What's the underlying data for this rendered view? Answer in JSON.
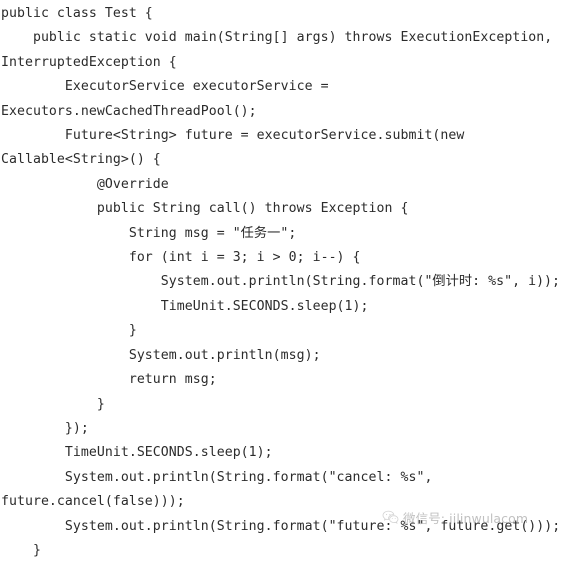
{
  "document": {
    "type": "code-snippet",
    "language": "java",
    "background_color": "#ffffff",
    "text_color": "#2b2b2b"
  },
  "code": {
    "lines": [
      "public class Test {",
      "    public static void main(String[] args) throws ExecutionException,",
      "InterruptedException {",
      "        ExecutorService executorService =",
      "Executors.newCachedThreadPool();",
      "        Future<String> future = executorService.submit(new",
      "Callable<String>() {",
      "            @Override",
      "            public String call() throws Exception {",
      "                String msg = \"任务一\";",
      "                for (int i = 3; i > 0; i--) {",
      "                    System.out.println(String.format(\"倒计时: %s\", i));",
      "                    TimeUnit.SECONDS.sleep(1);",
      "                }",
      "                System.out.println(msg);",
      "                return msg;",
      "            }",
      "        });",
      "        TimeUnit.SECONDS.sleep(1);",
      "        System.out.println(String.format(\"cancel: %s\",",
      "future.cancel(false)));",
      "        System.out.println(String.format(\"future: %s\", future.get()));",
      "    }"
    ]
  },
  "watermark": {
    "icon": "wechat-icon",
    "text": "微信号: jilinwulacom",
    "color": "#9a9a9a"
  }
}
